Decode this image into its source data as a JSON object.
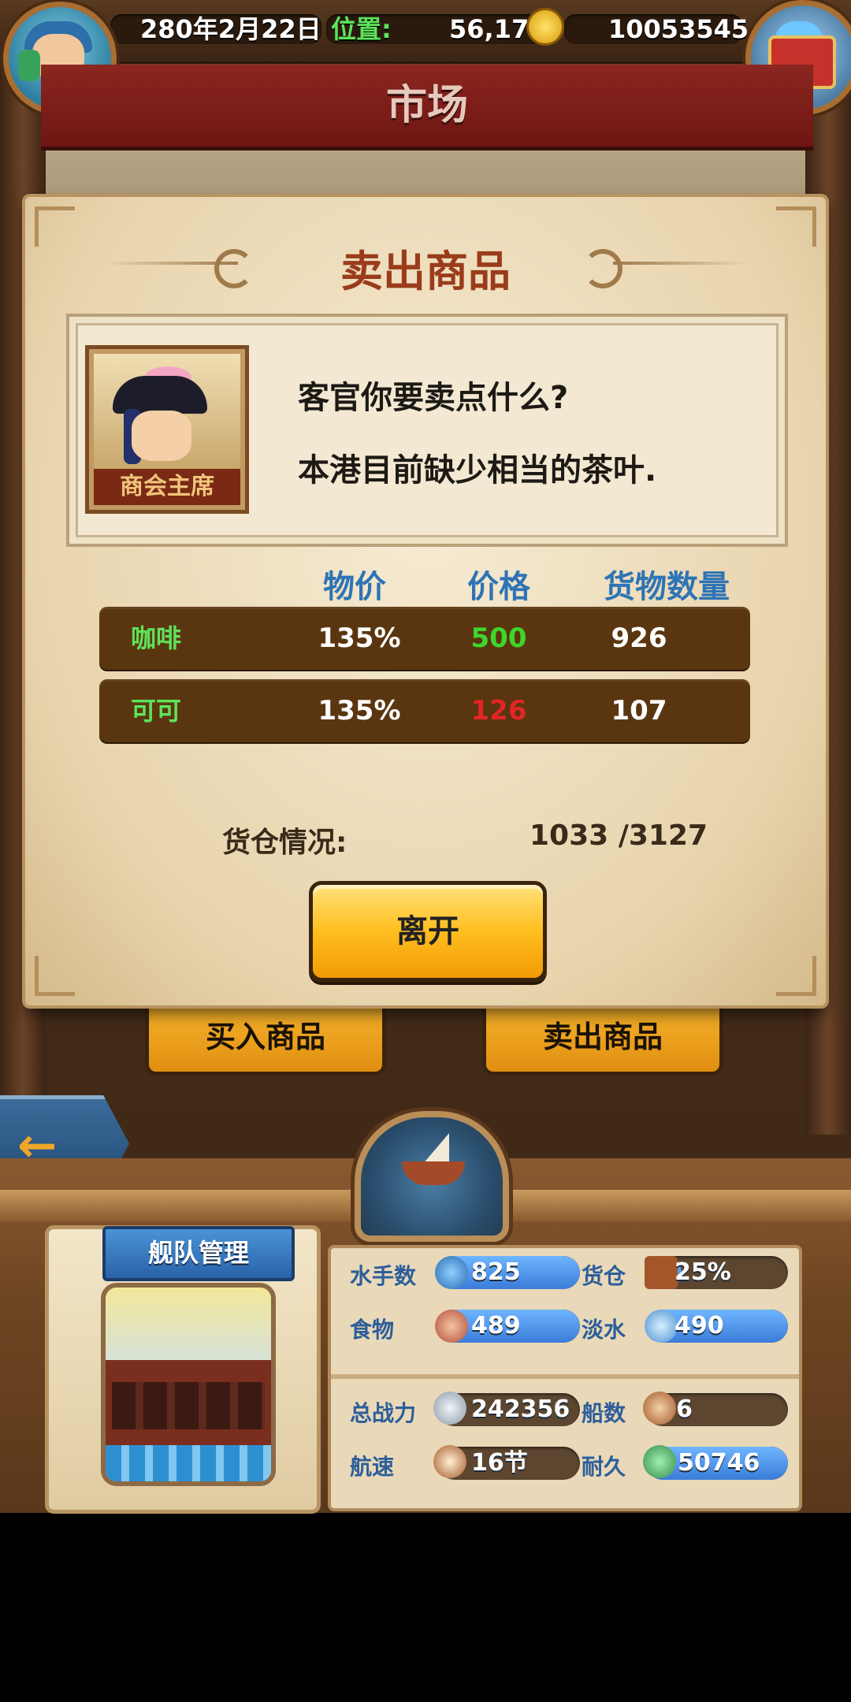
{
  "status_bar": {
    "date": "280年2月22日",
    "position_label": "位置:",
    "position_value": "56,17",
    "gold": "10053545"
  },
  "market": {
    "title": "市场"
  },
  "dialog": {
    "title": "卖出商品",
    "npc_title": "商会主席",
    "lines": [
      "客官你要卖点什么?",
      "本港目前缺少相当的茶叶."
    ],
    "table": {
      "headers": [
        "物价",
        "价格",
        "货物数量"
      ],
      "rows": [
        {
          "name": "咖啡",
          "price_index": "135%",
          "price": "500",
          "price_color": "#3fd62a",
          "quantity": "926"
        },
        {
          "name": "可可",
          "price_index": "135%",
          "price": "126",
          "price_color": "#e02626",
          "quantity": "107"
        }
      ]
    },
    "cargo_label": "货仓情况:",
    "cargo_value": "1033 /3127",
    "leave_button": "离开"
  },
  "under_buttons": {
    "buy": "买入商品",
    "sell": "卖出商品"
  },
  "fleet": {
    "banner": "舰队管理",
    "stats": [
      {
        "label": "水手数",
        "value": "825",
        "fill": 1.0,
        "icon": "sailor-icon"
      },
      {
        "label": "货仓",
        "value": "25%",
        "fill": 0.25,
        "icon": "cargo-crate-icon"
      },
      {
        "label": "食物",
        "value": "489",
        "fill": 1.0,
        "icon": "meat-icon"
      },
      {
        "label": "淡水",
        "value": "490",
        "fill": 1.0,
        "icon": "water-jug-icon"
      },
      {
        "label": "总战力",
        "value": "242356",
        "fill": 1.0,
        "icon": "skull-swords-icon"
      },
      {
        "label": "船数",
        "value": "6",
        "fill": 0.0,
        "icon": "ship-count-icon"
      },
      {
        "label": "航速",
        "value": "16节",
        "fill": 0.0,
        "icon": "sail-speed-icon"
      },
      {
        "label": "耐久",
        "value": "50746",
        "fill": 1.0,
        "icon": "ship-durability-icon"
      }
    ]
  },
  "colors": {
    "accent_red": "#8c2620",
    "button_gold": "#ffbe1f",
    "stat_blue": "#3a7cd8"
  }
}
